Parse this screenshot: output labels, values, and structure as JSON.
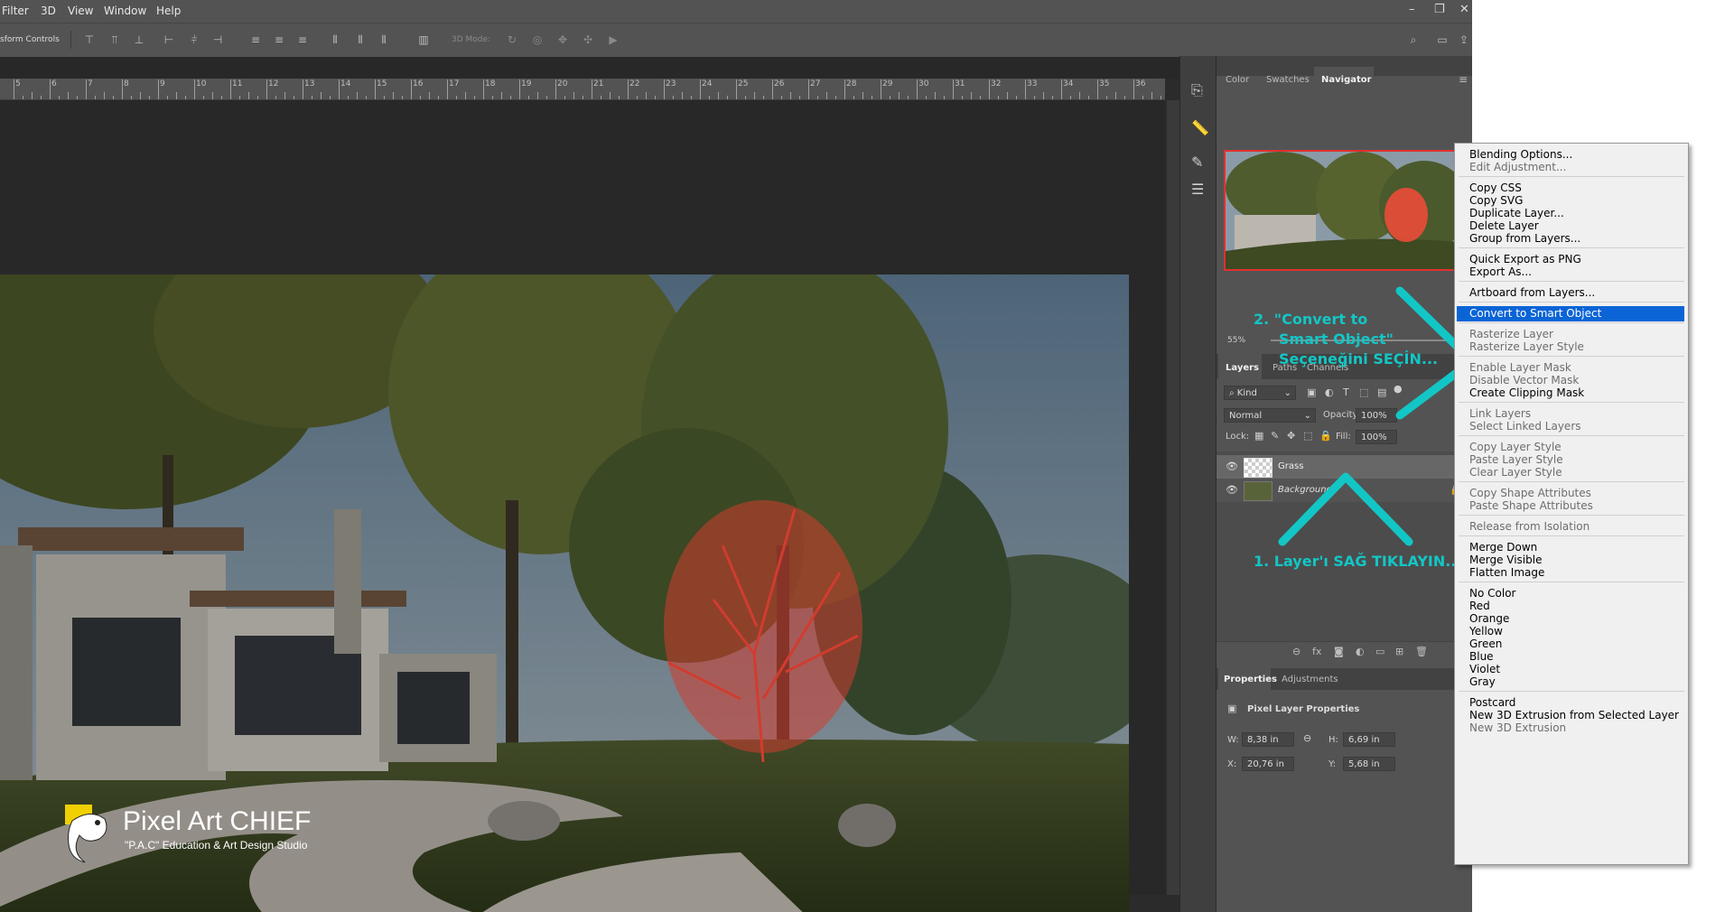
{
  "menubar": {
    "items": [
      "Filter",
      "3D",
      "View",
      "Window",
      "Help"
    ],
    "window_buttons": [
      "–",
      "❐",
      "✕"
    ]
  },
  "options_bar": {
    "transform_label": "sform Controls",
    "mode_3d_label": "3D Mode:"
  },
  "ruler": {
    "ticks": [
      "5",
      "6",
      "7",
      "8",
      "9",
      "10",
      "11",
      "12",
      "13",
      "14",
      "15",
      "16",
      "17",
      "18",
      "19",
      "20",
      "21",
      "22",
      "23",
      "24",
      "25",
      "26",
      "27",
      "28",
      "29",
      "30",
      "31",
      "32",
      "33",
      "34",
      "35",
      "36"
    ]
  },
  "top_panel": {
    "tabs": [
      "Color",
      "Swatches",
      "Navigator"
    ],
    "zoom": "55%"
  },
  "layers_panel": {
    "tabs": [
      "Layers",
      "Paths",
      "Channels"
    ],
    "filter_label": "Kind",
    "blend_mode": "Normal",
    "opacity_label": "Opacity:",
    "opacity": "100%",
    "lock_label": "Lock:",
    "fill_label": "Fill:",
    "fill": "100%",
    "layers": [
      {
        "name": "Grass"
      },
      {
        "name": "Background"
      }
    ]
  },
  "properties_panel": {
    "tabs": [
      "Properties",
      "Adjustments"
    ],
    "header": "Pixel Layer Properties",
    "w_label": "W:",
    "w_value": "8,38 in",
    "h_label": "H:",
    "h_value": "6,69 in",
    "x_label": "X:",
    "x_value": "20,76 in",
    "y_label": "Y:",
    "y_value": "5,68 in"
  },
  "annotations": {
    "step2_line1": "2. \"Convert to",
    "step2_line2": "Smart Object\"",
    "step2_line3": "Seçeneğini SEÇİN...",
    "step1": "1. Layer'ı SAĞ TIKLAYIN..",
    "color": "#13c6c6"
  },
  "watermark": {
    "title": "Pixel Art CHIEF",
    "subtitle": "\"P.A.C\" Education & Art Design Studio"
  },
  "context_menu": {
    "highlight_color": "#0b64d6",
    "groups": [
      [
        {
          "label": "Blending Options...",
          "enabled": true
        },
        {
          "label": "Edit Adjustment...",
          "enabled": false
        }
      ],
      [
        {
          "label": "Copy CSS",
          "enabled": true
        },
        {
          "label": "Copy SVG",
          "enabled": true
        },
        {
          "label": "Duplicate Layer...",
          "enabled": true
        },
        {
          "label": "Delete Layer",
          "enabled": true
        },
        {
          "label": "Group from Layers...",
          "enabled": true
        }
      ],
      [
        {
          "label": "Quick Export as PNG",
          "enabled": true
        },
        {
          "label": "Export As...",
          "enabled": true
        }
      ],
      [
        {
          "label": "Artboard from Layers...",
          "enabled": true
        }
      ],
      [
        {
          "label": "Convert to Smart Object",
          "enabled": true,
          "highlighted": true
        }
      ],
      [
        {
          "label": "Rasterize Layer",
          "enabled": false
        },
        {
          "label": "Rasterize Layer Style",
          "enabled": false
        }
      ],
      [
        {
          "label": "Enable Layer Mask",
          "enabled": false
        },
        {
          "label": "Disable Vector Mask",
          "enabled": false
        },
        {
          "label": "Create Clipping Mask",
          "enabled": true
        }
      ],
      [
        {
          "label": "Link Layers",
          "enabled": false
        },
        {
          "label": "Select Linked Layers",
          "enabled": false
        }
      ],
      [
        {
          "label": "Copy Layer Style",
          "enabled": false
        },
        {
          "label": "Paste Layer Style",
          "enabled": false
        },
        {
          "label": "Clear Layer Style",
          "enabled": false
        }
      ],
      [
        {
          "label": "Copy Shape Attributes",
          "enabled": false
        },
        {
          "label": "Paste Shape Attributes",
          "enabled": false
        }
      ],
      [
        {
          "label": "Release from Isolation",
          "enabled": false
        }
      ],
      [
        {
          "label": "Merge Down",
          "enabled": true
        },
        {
          "label": "Merge Visible",
          "enabled": true
        },
        {
          "label": "Flatten Image",
          "enabled": true
        }
      ],
      [
        {
          "label": "No Color",
          "enabled": true
        },
        {
          "label": "Red",
          "enabled": true
        },
        {
          "label": "Orange",
          "enabled": true
        },
        {
          "label": "Yellow",
          "enabled": true
        },
        {
          "label": "Green",
          "enabled": true
        },
        {
          "label": "Blue",
          "enabled": true
        },
        {
          "label": "Violet",
          "enabled": true
        },
        {
          "label": "Gray",
          "enabled": true
        }
      ],
      [
        {
          "label": "Postcard",
          "enabled": true
        },
        {
          "label": "New 3D Extrusion from Selected Layer",
          "enabled": true
        },
        {
          "label": "New 3D Extrusion",
          "enabled": false
        }
      ]
    ]
  }
}
